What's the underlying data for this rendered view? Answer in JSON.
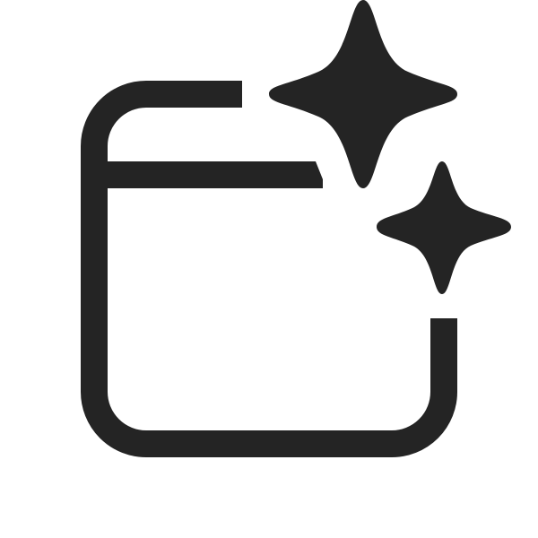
{
  "icon": {
    "name": "window-sparkle-icon",
    "color": "#242424",
    "background": "#ffffff"
  }
}
